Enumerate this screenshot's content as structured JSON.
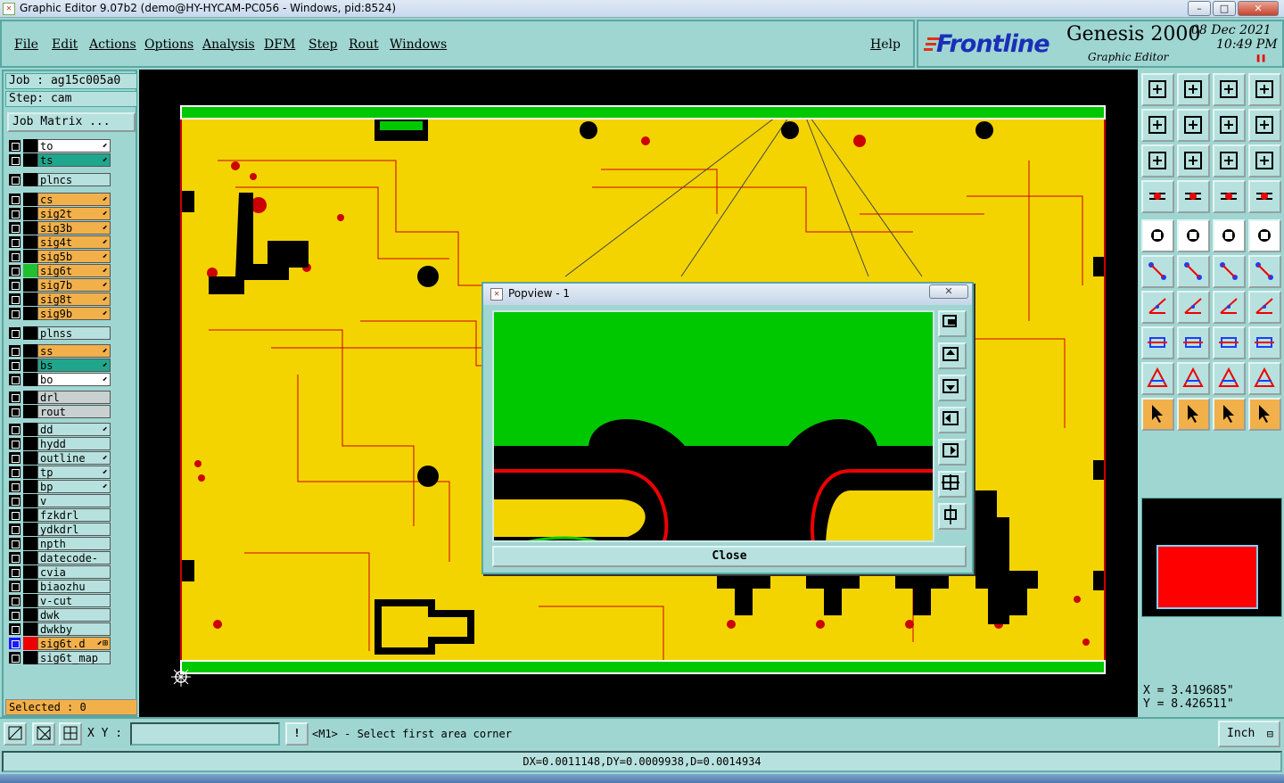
{
  "window": {
    "title": "Graphic Editor 9.07b2 (demo@HY-HYCAM-PC056 - Windows, pid:8524)",
    "minimize": "–",
    "maximize": "□",
    "close": "✕"
  },
  "menu": {
    "items": [
      "File",
      "Edit",
      "Actions",
      "Options",
      "Analysis",
      "DFM",
      "Step",
      "Rout",
      "Windows"
    ],
    "help": "Help"
  },
  "logo": {
    "brand": "Frontline",
    "product": "Genesis 2000",
    "subtitle": "Graphic Editor",
    "date": "08 Dec 2021",
    "time": "10:49 PM"
  },
  "job": {
    "job_label": "Job : ag15c005a0",
    "step_label": "Step: cam",
    "matrix_button": "Job Matrix ..."
  },
  "layers": [
    {
      "name": "to",
      "color": "#ffffff",
      "arrow": "⬋"
    },
    {
      "name": "ts",
      "color": "#1fa78d",
      "arrow": "⬋"
    },
    {
      "name": "plncs",
      "color": "#b7e1de",
      "arrow": ""
    },
    {
      "name": "cs",
      "color": "#f2b04a",
      "arrow": "⬋"
    },
    {
      "name": "sig2t",
      "color": "#f2b04a",
      "arrow": "⬋"
    },
    {
      "name": "sig3b",
      "color": "#f2b04a",
      "arrow": "⬋"
    },
    {
      "name": "sig4t",
      "color": "#f2b04a",
      "arrow": "⬋"
    },
    {
      "name": "sig5b",
      "color": "#f2b04a",
      "arrow": "⬋"
    },
    {
      "name": "sig6t",
      "color": "#f2b04a",
      "arrow": "⬋"
    },
    {
      "name": "sig7b",
      "color": "#f2b04a",
      "arrow": "⬋"
    },
    {
      "name": "sig8t",
      "color": "#f2b04a",
      "arrow": "⬋"
    },
    {
      "name": "sig9b",
      "color": "#f2b04a",
      "arrow": "⬋"
    },
    {
      "name": "plnss",
      "color": "#b7e1de",
      "arrow": ""
    },
    {
      "name": "ss",
      "color": "#f2b04a",
      "arrow": "⬋"
    },
    {
      "name": "bs",
      "color": "#1fa78d",
      "arrow": "⬋"
    },
    {
      "name": "bo",
      "color": "#ffffff",
      "arrow": "⬋"
    },
    {
      "name": "drl",
      "color": "#c8d0d0",
      "arrow": ""
    },
    {
      "name": "rout",
      "color": "#c8d0d0",
      "arrow": ""
    },
    {
      "name": "dd",
      "color": "#b7e1de",
      "arrow": "⬋"
    },
    {
      "name": "hydd",
      "color": "#b7e1de",
      "arrow": ""
    },
    {
      "name": "outline",
      "color": "#b7e1de",
      "arrow": "⬋"
    },
    {
      "name": "tp",
      "color": "#b7e1de",
      "arrow": "⬋"
    },
    {
      "name": "bp",
      "color": "#b7e1de",
      "arrow": "⬋"
    },
    {
      "name": "v",
      "color": "#b7e1de",
      "arrow": ""
    },
    {
      "name": "fzkdrl",
      "color": "#b7e1de",
      "arrow": ""
    },
    {
      "name": "ydkdrl",
      "color": "#b7e1de",
      "arrow": ""
    },
    {
      "name": "npth",
      "color": "#b7e1de",
      "arrow": ""
    },
    {
      "name": "datecode-to",
      "color": "#b7e1de",
      "arrow": ""
    },
    {
      "name": "cvia",
      "color": "#b7e1de",
      "arrow": ""
    },
    {
      "name": "biaozhu",
      "color": "#b7e1de",
      "arrow": ""
    },
    {
      "name": "v-cut",
      "color": "#b7e1de",
      "arrow": ""
    },
    {
      "name": "dwk",
      "color": "#b7e1de",
      "arrow": ""
    },
    {
      "name": "dwkby",
      "color": "#b7e1de",
      "arrow": ""
    },
    {
      "name": "sig6t.d",
      "color": "#f2b04a",
      "arrow": "⬋⊞"
    },
    {
      "name": "sig6t_map",
      "color": "#b7e1de",
      "arrow": ""
    }
  ],
  "selected_label": "Selected : 0",
  "popview": {
    "title": "Popview - 1",
    "close_x": "✕",
    "close_button": "Close"
  },
  "coords": {
    "x": "X = 3.419685\"",
    "y": "Y = 8.426511\""
  },
  "command": {
    "xy_label": "X Y :",
    "xy_value": "",
    "message": "<M1> - Select first area corner",
    "units": "Inch"
  },
  "status": "DX=0.0011148,DY=0.0009938,D=0.0014934",
  "colors": {
    "panel": "#9fd6d2",
    "board_yellow": "#f3d400",
    "copper_green": "#00c800",
    "trace_red": "#cc0000"
  }
}
